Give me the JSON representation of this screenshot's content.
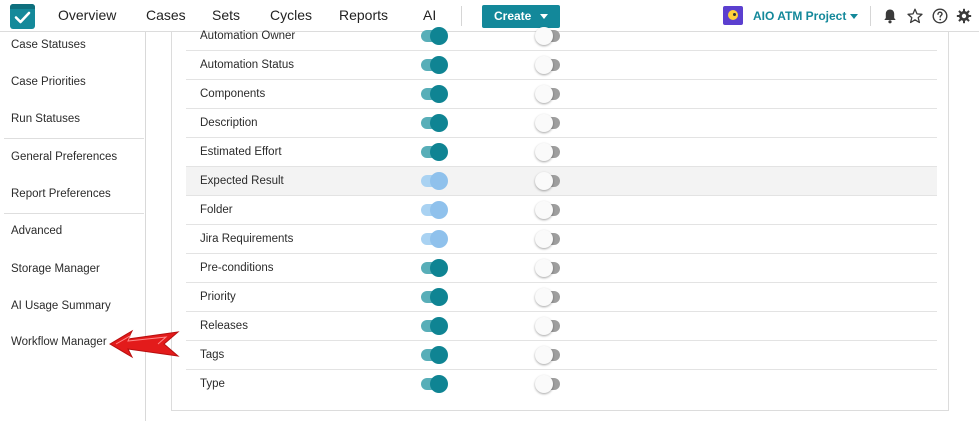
{
  "topbar": {
    "nav": [
      "Overview",
      "Cases",
      "Sets",
      "Cycles",
      "Reports",
      "AI"
    ],
    "create_label": "Create",
    "project_name": "AIO ATM Project",
    "icons": [
      "bell-icon",
      "star-icon",
      "help-icon",
      "gear-icon"
    ]
  },
  "sidebar": {
    "items": [
      "Case Statuses",
      "Case Priorities",
      "Run Statuses",
      "General Preferences",
      "Report Preferences",
      "Advanced",
      "Storage Manager",
      "AI Usage Summary",
      "Workflow Manager"
    ]
  },
  "fields": [
    {
      "name": "Automation Owner",
      "first": "on",
      "second": "off"
    },
    {
      "name": "Automation Status",
      "first": "on",
      "second": "off"
    },
    {
      "name": "Components",
      "first": "on",
      "second": "off"
    },
    {
      "name": "Description",
      "first": "on",
      "second": "off"
    },
    {
      "name": "Estimated Effort",
      "first": "on",
      "second": "off"
    },
    {
      "name": "Expected Result",
      "first": "disabled-on",
      "second": "off"
    },
    {
      "name": "Folder",
      "first": "disabled-on",
      "second": "off"
    },
    {
      "name": "Jira Requirements",
      "first": "disabled-on",
      "second": "off"
    },
    {
      "name": "Pre-conditions",
      "first": "on",
      "second": "off"
    },
    {
      "name": "Priority",
      "first": "on",
      "second": "off"
    },
    {
      "name": "Releases",
      "first": "on",
      "second": "off"
    },
    {
      "name": "Tags",
      "first": "on",
      "second": "off"
    },
    {
      "name": "Type",
      "first": "on",
      "second": "off"
    }
  ],
  "colors": {
    "accent": "#13889a",
    "toggle_on_knob": "#0f8493",
    "toggle_disabled_knob": "#8fc1ec",
    "pointer_arrow": "#e31b1b"
  }
}
